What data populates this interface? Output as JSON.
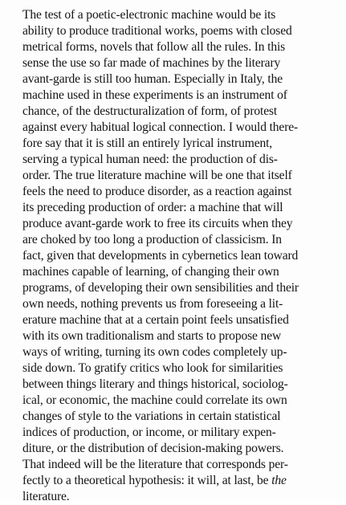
{
  "document": {
    "lines": [
      "The test of a poetic-electronic machine would be its",
      "ability to produce traditional works, poems with closed",
      "metrical forms, novels that follow all the rules. In this",
      "sense the use so far made of machines by the literary",
      "avant-garde is still too human. Especially in Italy, the",
      "machine used in these experiments is an instrument of",
      "chance, of the destructuralization of form, of protest",
      "against every habitual logical connection. I would there-",
      "fore say that it is still an entirely lyrical instrument,",
      "serving a typical human need: the production of dis-",
      "order. The true literature machine will be one that itself",
      "feels the need to produce disorder, as a reaction against",
      "its preceding production of order: a machine that will",
      "produce avant-garde work to free its circuits when they",
      "are choked by too long a production of classicism. In",
      "fact, given that developments in cybernetics lean toward",
      "machines capable of learning, of changing their own",
      "programs, of developing their own sensibilities and their",
      "own needs, nothing prevents us from foreseeing a lit-",
      "erature machine that at a certain point feels unsatisfied",
      "with its own traditionalism and starts to propose new",
      "ways of writing, turning its own codes completely up-",
      "side down. To gratify critics who look for similarities",
      "between things literary and things historical, sociolog-",
      "ical, or economic, the machine could correlate its own",
      "changes of style to the variations in certain statistical",
      "indices of production, or income, or military expen-",
      "diture, or the distribution of decision-making powers.",
      "That indeed will be the literature that corresponds per-",
      "fectly to a theoretical hypothesis: it will, at last, be"
    ],
    "last_line_emphasis": "the",
    "final_line": "literature."
  }
}
